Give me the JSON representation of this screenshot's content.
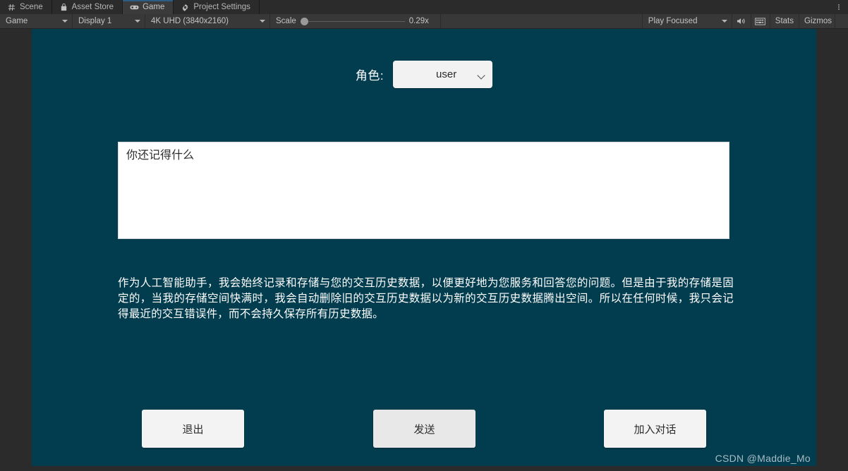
{
  "window": {
    "tabs": [
      {
        "label": "Scene",
        "icon": "grid-icon",
        "active": false
      },
      {
        "label": "Asset Store",
        "icon": "shop-bag-icon",
        "active": false
      },
      {
        "label": "Game",
        "icon": "gamepad-icon",
        "active": true
      },
      {
        "label": "Project Settings",
        "icon": "gear-icon",
        "active": false
      }
    ],
    "menu_icon": "kebab-menu-icon"
  },
  "toolbar": {
    "view_mode": "Game",
    "display": "Display 1",
    "resolution": "4K UHD (3840x2160)",
    "scale_label": "Scale",
    "scale_value": "0.29x",
    "play_mode": "Play Focused",
    "mute_icon": "speaker-icon",
    "stats_grid_icon": "stats-grid-icon",
    "stats_label": "Stats",
    "gizmos_label": "Gizmos"
  },
  "game": {
    "background_color": "#023d4f",
    "role": {
      "label": "角色:",
      "value": "user"
    },
    "input": {
      "value": "你还记得什么",
      "placeholder": ""
    },
    "reply": "作为人工智能助手，我会始终记录和存储与您的交互历史数据，以便更好地为您服务和回答您的问题。但是由于我的存储是固定的，当我的存储空间快满时，我会自动删除旧的交互历史数据以为新的交互历史数据腾出空间。所以在任何时候，我只会记得最近的交互错误件，而不会持久保存所有历史数据。",
    "buttons": {
      "exit": "退出",
      "send": "发送",
      "join": "加入对话"
    },
    "watermark": "CSDN @Maddie_Mo"
  }
}
